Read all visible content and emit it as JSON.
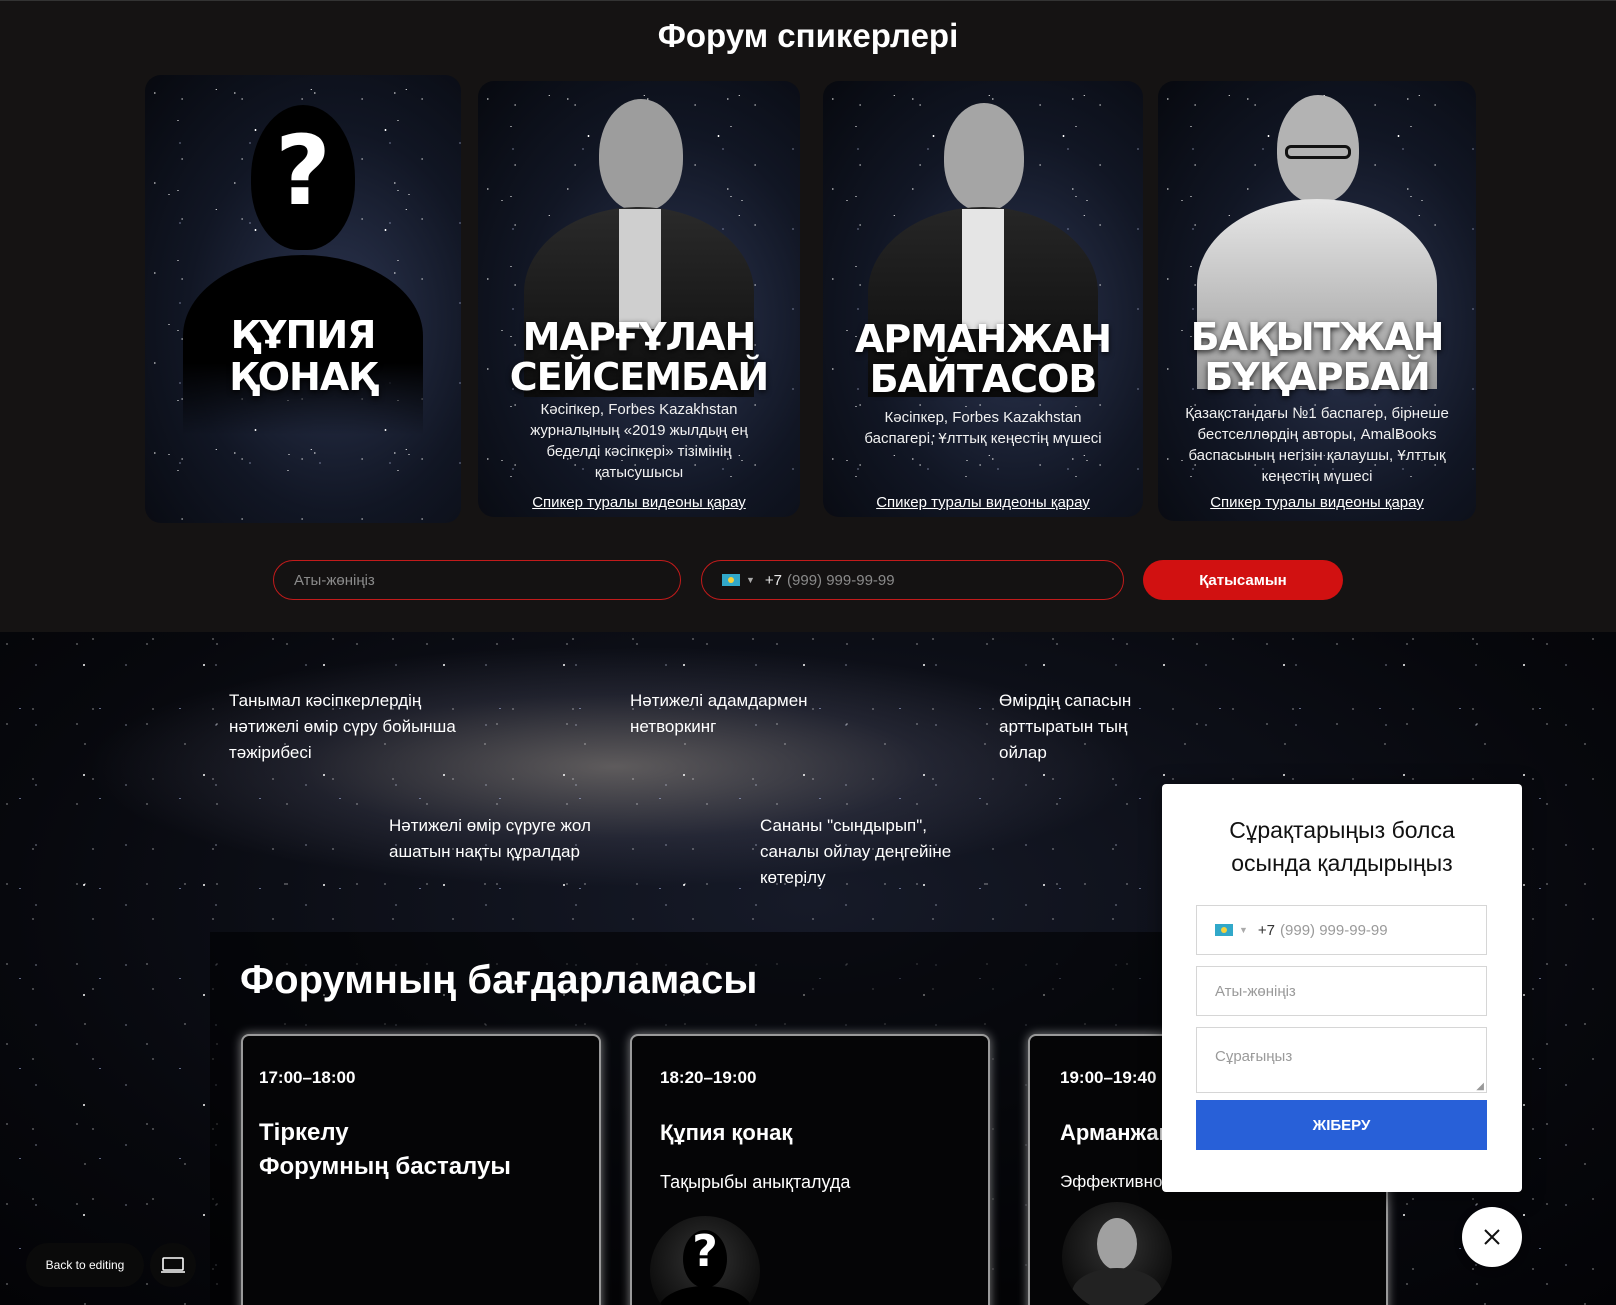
{
  "speakers_section": {
    "title": "Форум спикерлері",
    "cards": [
      {
        "name_line1": "ҚҰПИЯ",
        "name_line2": "ҚОНАҚ",
        "mystery_mark": "?"
      },
      {
        "name_line1": "МАРҒҰЛАН",
        "name_line2": "СЕЙСЕМБАЙ",
        "description": "Кәсіпкер, Forbes Kazakhstan журналының «2019 жылдың ең беделді кәсіпкері» тізімінің қатысушысы",
        "link": "Спикер туралы видеоны қарау"
      },
      {
        "name_line1": "АРМАНЖАН",
        "name_line2": "БАЙТАСОВ",
        "description": "Кәсіпкер, Forbes Kazakhstan баспагері, Ұлттық кеңестің мүшесі",
        "link": "Спикер туралы видеоны қарау"
      },
      {
        "name_line1": "БАҚЫТЖАН",
        "name_line2": "БҰҚАРБАЙ",
        "description": "Қазақстандағы №1 баспагер, бірнеше бестселлердің авторы, AmalBooks баспасының негізін қалаушы, Ұлттық кеңестің мүшесі",
        "link": "Спикер туралы видеоны қарау"
      }
    ],
    "form": {
      "name_placeholder": "Аты-жөніңіз",
      "phone_code": "+7",
      "phone_placeholder": "(999) 999-99-99",
      "submit_label": "Қатысамын"
    }
  },
  "benefits": [
    "Танымал кәсіпкерлердің нәтижелі өмір сүру бойынша тәжірибесі",
    "Нәтижелі адамдармен нетворкинг",
    "Өмірдің сапасын арттыратын тың ойлар",
    "Нәтижелі өмір сүруге жол ашатын нақты құралдар",
    "Сананы \"сындырып\", саналы ойлау деңгейіне көтерілу"
  ],
  "program": {
    "title": "Форумның бағдарламасы",
    "items": [
      {
        "time": "17:00–18:00",
        "title_line1": "Тіркелу",
        "title_line2": "Форумның басталуы"
      },
      {
        "time": "18:20–19:00",
        "title": "Құпия қонақ",
        "subtitle": "Тақырыбы анықталуда",
        "avatar_mark": "?"
      },
      {
        "time": "19:00–19:40",
        "title": "Арманжан",
        "subtitle": "Эффективно"
      }
    ]
  },
  "popup": {
    "title": "Сұрақтарыңыз болса осында қалдырыңыз",
    "phone_code": "+7",
    "phone_placeholder": "(999) 999-99-99",
    "name_placeholder": "Аты-жөніңіз",
    "question_placeholder": "Сұрағыңыз",
    "submit_label": "ЖІБЕРУ"
  },
  "editor": {
    "back_label": "Back to editing"
  },
  "colors": {
    "accent_red": "#d11111",
    "submit_blue": "#2860d8",
    "flag_kz": "#31a8c9"
  },
  "icons": [
    "question-mark-icon",
    "flag-kz-icon",
    "caret-down-icon",
    "close-icon",
    "laptop-icon"
  ]
}
